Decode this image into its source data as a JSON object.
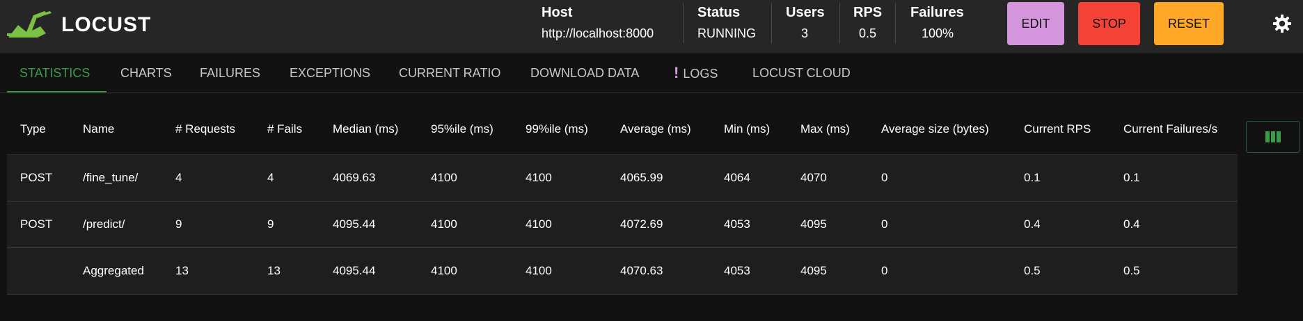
{
  "app": {
    "name": "LOCUST",
    "accent": "#3b9a48"
  },
  "header": {
    "host": {
      "label": "Host",
      "value": "http://localhost:8000"
    },
    "status": {
      "label": "Status",
      "value": "RUNNING"
    },
    "users": {
      "label": "Users",
      "value": "3"
    },
    "rps": {
      "label": "RPS",
      "value": "0.5"
    },
    "failures": {
      "label": "Failures",
      "value": "100%"
    },
    "buttons": {
      "edit": {
        "label": "EDIT",
        "color": "#d595dd"
      },
      "stop": {
        "label": "STOP",
        "color": "#f44336"
      },
      "reset": {
        "label": "RESET",
        "color": "#ffa726"
      }
    },
    "theme_icon": "gear-icon"
  },
  "tabs": [
    {
      "label": "STATISTICS",
      "active": true
    },
    {
      "label": "CHARTS"
    },
    {
      "label": "FAILURES"
    },
    {
      "label": "EXCEPTIONS"
    },
    {
      "label": "CURRENT RATIO"
    },
    {
      "label": "DOWNLOAD DATA"
    },
    {
      "label": "LOGS",
      "icon": "!"
    },
    {
      "label": "LOCUST CLOUD"
    }
  ],
  "table": {
    "columns": [
      "Type",
      "Name",
      "# Requests",
      "# Fails",
      "Median (ms)",
      "95%ile (ms)",
      "99%ile (ms)",
      "Average (ms)",
      "Min (ms)",
      "Max (ms)",
      "Average size (bytes)",
      "Current RPS",
      "Current Failures/s"
    ],
    "rows": [
      [
        "POST",
        "/fine_tune/",
        "4",
        "4",
        "4069.63",
        "4100",
        "4100",
        "4065.99",
        "4064",
        "4070",
        "0",
        "0.1",
        "0.1"
      ],
      [
        "POST",
        "/predict/",
        "9",
        "9",
        "4095.44",
        "4100",
        "4100",
        "4072.69",
        "4053",
        "4095",
        "0",
        "0.4",
        "0.4"
      ],
      [
        "",
        "Aggregated",
        "13",
        "13",
        "4095.44",
        "4100",
        "4100",
        "4070.63",
        "4053",
        "4095",
        "0",
        "0.5",
        "0.5"
      ]
    ]
  },
  "column_selector_icon": "columns-icon"
}
